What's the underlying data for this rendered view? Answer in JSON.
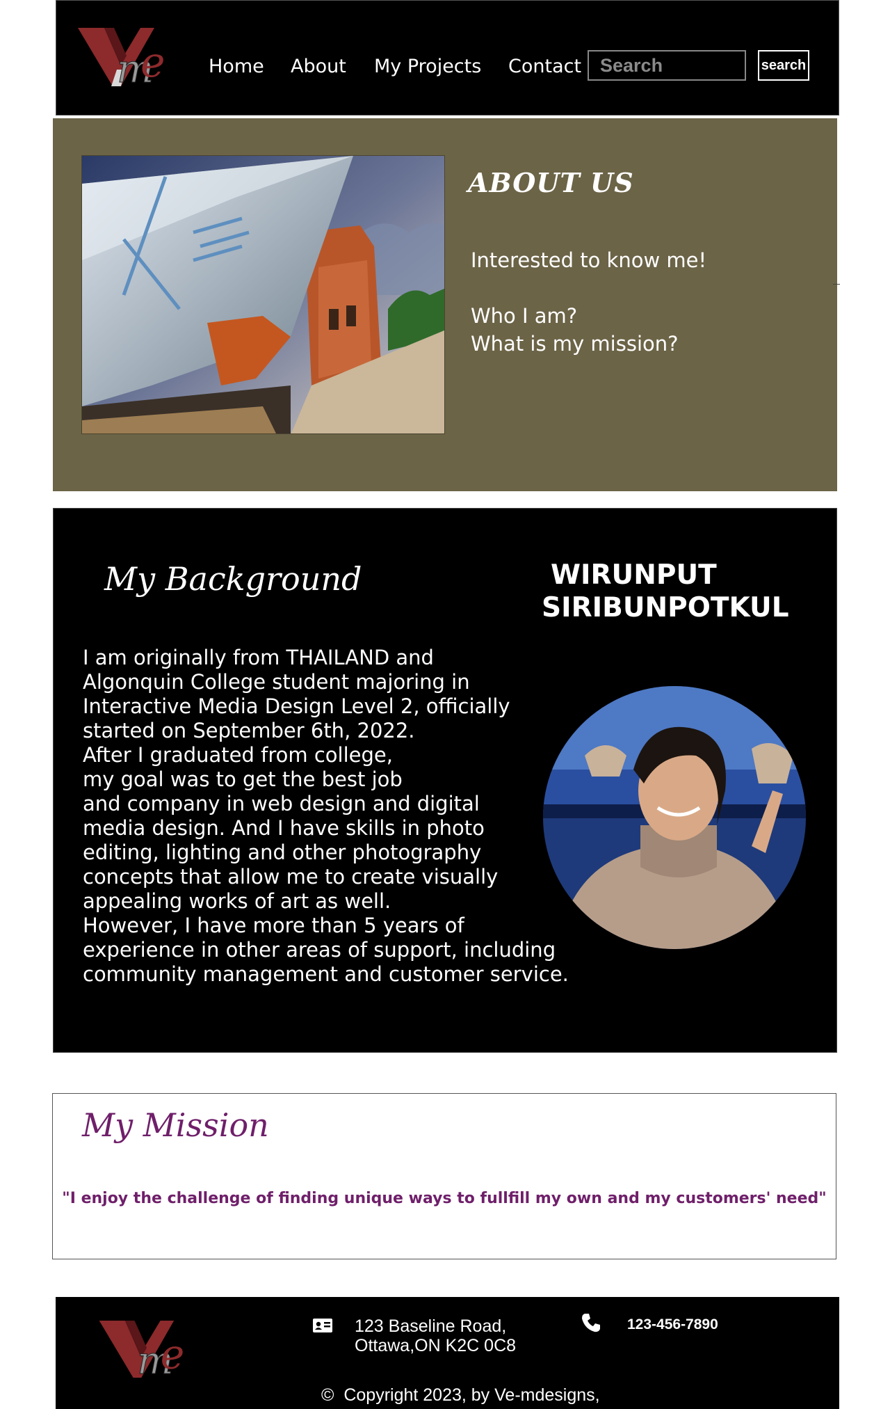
{
  "header": {
    "logo_alt": "Ve logo",
    "nav": [
      {
        "label": "Home"
      },
      {
        "label": "About"
      },
      {
        "label": "My Projects"
      },
      {
        "label": "Contact"
      }
    ],
    "search": {
      "placeholder": "Search",
      "button_label": "search"
    }
  },
  "about": {
    "title": "ABOUT US",
    "lines": [
      "Interested to know me!",
      "Who I am?",
      "What is my mission?"
    ],
    "background_color": "#6c6447"
  },
  "background": {
    "heading": "My Background",
    "name_line1": "WIRUNPUT",
    "name_line2": "SIRIBUNPOTKUL",
    "text": "   I am originally from THAILAND and\nAlgonquin College student majoring in\nInteractive Media Design Level 2, officially\nstarted on September 6th, 2022.\n     After I graduated from college,\nmy goal was to get the best job\nand company in web design and digital\nmedia design. And I have skills in photo\nediting, lighting  and other photography\nconcepts that allow me to create visually\nappealing works of art as well.\nHowever, I have more than 5 years of\nexperience in other areas of support, including\ncommunity management and customer service."
  },
  "mission": {
    "heading": "My Mission",
    "quote": "\"I enjoy the challenge of finding unique ways to fullfill my own and my customers' need\"",
    "accent_color": "#6f1f6a"
  },
  "footer": {
    "address_line1": "123 Baseline Road,",
    "address_line2": "Ottawa,ON K2C 0C8",
    "phone": "123-456-7890",
    "copyright_symbol": "©",
    "copyright": "Copyright 2023, by Ve-mdesigns,"
  },
  "icons": {
    "logo": "ve-logo-icon",
    "address": "contact-card-icon",
    "phone": "phone-icon"
  }
}
